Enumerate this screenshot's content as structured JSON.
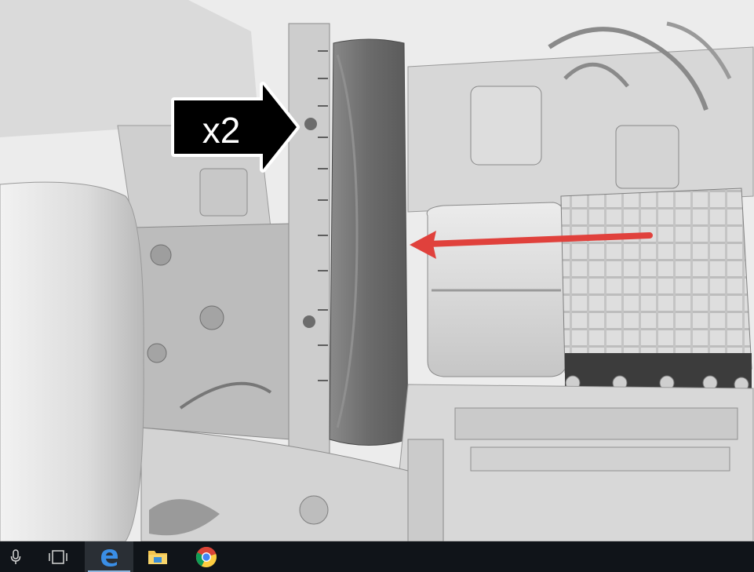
{
  "illustration": {
    "callout_label": "x2",
    "callout_color": "#000000",
    "pointer_arrow_color": "#e0413c",
    "shading_colors": {
      "background": "#ebebeb",
      "light": "#d9d9d9",
      "mid": "#b4b4b4",
      "dark": "#777777",
      "belt": "#686868"
    }
  },
  "taskbar": {
    "background": "#101419",
    "icons": [
      "microphone-icon",
      "task-view-icon",
      "edge-icon",
      "file-explorer-icon",
      "chrome-icon"
    ],
    "active_app": "edge"
  }
}
